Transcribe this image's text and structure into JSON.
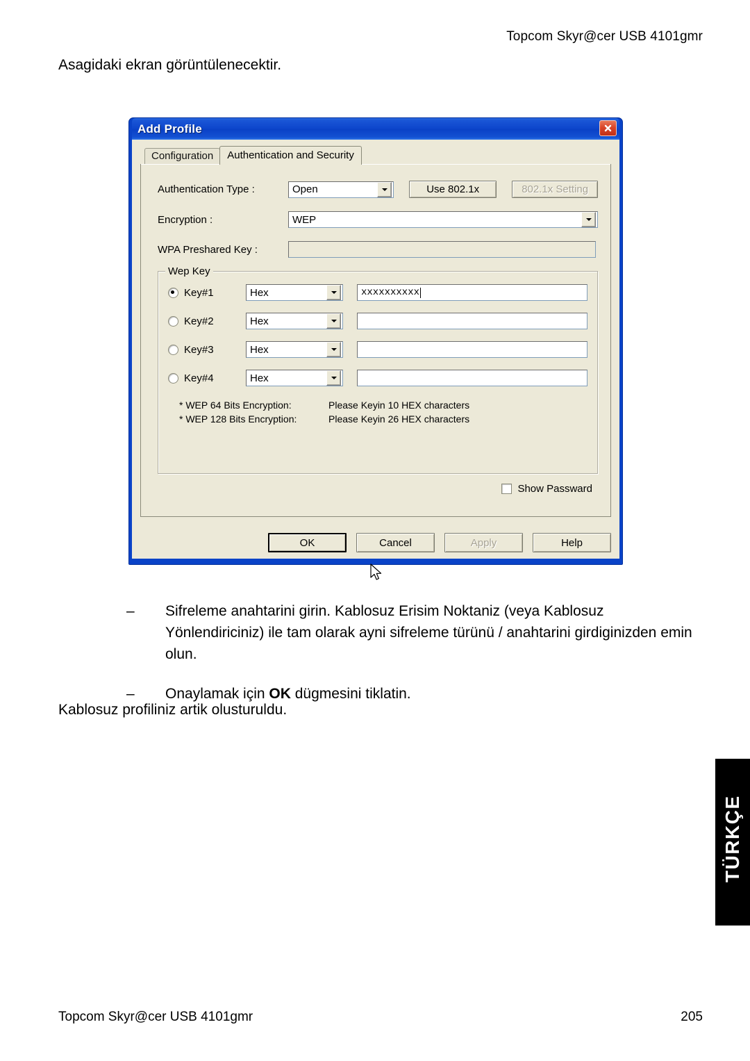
{
  "page": {
    "header_right": "Topcom Skyr@cer USB 4101gmr",
    "intro": "Asagidaki ekran görüntülenecektir.",
    "closing": "Kablosuz profiliniz artik olusturuldu.",
    "language_tab": "TÜRKÇE",
    "footer_left": "Topcom Skyr@cer USB 4101gmr",
    "footer_right": "205"
  },
  "bullets": [
    {
      "dash": "–",
      "text_before": "Sifreleme anahtarini girin. Kablosuz Erisim Noktaniz (veya Kablosuz Yönlendiriciniz) ile tam olarak ayni sifreleme türünü / anahtarini girdiginizden emin olun.",
      "bold": "",
      "text_after": ""
    },
    {
      "dash": "–",
      "text_before": "Onaylamak için ",
      "bold": "OK",
      "text_after": " dügmesini tiklatin."
    }
  ],
  "dialog": {
    "title": "Add Profile",
    "close_icon": "close-icon",
    "tabs": [
      {
        "label": "Configuration",
        "active": false
      },
      {
        "label": "Authentication and Security",
        "active": true
      }
    ],
    "fields": {
      "auth_type_label": "Authentication Type :",
      "auth_type_value": "Open",
      "use_8021x_label": "Use 802.1x",
      "setting_8021x_label": "802.1x Setting",
      "encryption_label": "Encryption :",
      "encryption_value": "WEP",
      "wpa_key_label": "WPA Preshared Key :",
      "wpa_key_value": ""
    },
    "wep_group": {
      "title": "Wep Key",
      "keys": [
        {
          "label": "Key#1",
          "selected": true,
          "format": "Hex",
          "value": "xxxxxxxxxx"
        },
        {
          "label": "Key#2",
          "selected": false,
          "format": "Hex",
          "value": ""
        },
        {
          "label": "Key#3",
          "selected": false,
          "format": "Hex",
          "value": ""
        },
        {
          "label": "Key#4",
          "selected": false,
          "format": "Hex",
          "value": ""
        }
      ],
      "hints": [
        {
          "key": "* WEP 64 Bits Encryption:",
          "text": "Please Keyin 10 HEX characters"
        },
        {
          "key": "* WEP 128 Bits Encryption:",
          "text": "Please Keyin 26 HEX characters"
        }
      ]
    },
    "show_password_label": "Show Passward",
    "show_password_checked": false,
    "buttons": [
      {
        "label": "OK",
        "state": "focused"
      },
      {
        "label": "Cancel",
        "state": "normal"
      },
      {
        "label": "Apply",
        "state": "disabled"
      },
      {
        "label": "Help",
        "state": "normal"
      }
    ],
    "colors": {
      "titlebar": "#0a43c8",
      "face": "#ece9d8",
      "close_button": "#d9452a"
    }
  }
}
